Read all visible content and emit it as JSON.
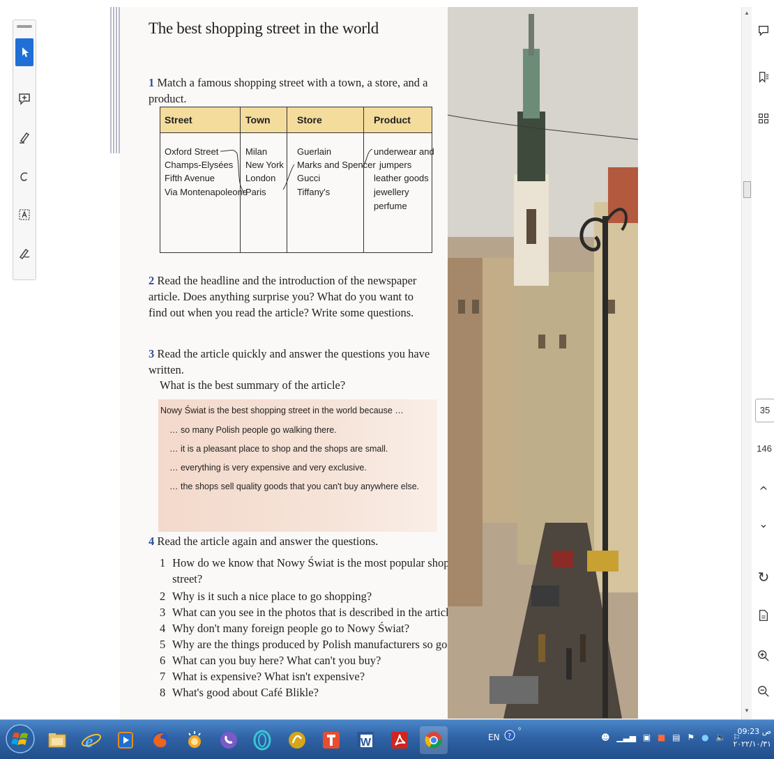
{
  "document": {
    "title": "The best shopping street in the world",
    "q1": {
      "num": "1",
      "text": "Match a famous shopping street with a town, a store, and a product."
    },
    "table": {
      "headers": [
        "Street",
        "Town",
        "Store",
        "Product"
      ],
      "street": [
        "Oxford Street",
        "Champs-Elysées",
        "Fifth Avenue",
        "Via Montenapoleone"
      ],
      "town": [
        "Milan",
        "New York",
        "London",
        "Paris"
      ],
      "store": [
        "Guerlain",
        "Marks and Spencer",
        "Gucci",
        "Tiffany's"
      ],
      "product": [
        "underwear and",
        "jumpers",
        "leather goods",
        "jewellery",
        "perfume"
      ]
    },
    "q2": {
      "num": "2",
      "text": "Read the headline and the introduction of the newspaper article. Does anything surprise you? What do you want to find out when you read the article? Write some questions."
    },
    "q3": {
      "num": "3",
      "text": "Read the article quickly and answer the questions you have written."
    },
    "summary_question": "What is the best summary of the article?",
    "summary": {
      "lead": "Nowy Świat is the best shopping street in the world because …",
      "options": [
        "… so many Polish people go walking there.",
        "… it is a pleasant place to shop and the shops are small.",
        "… everything is very expensive and very exclusive.",
        "… the shops sell quality goods that you can't buy anywhere else."
      ]
    },
    "q4": {
      "num": "4",
      "text": "Read the article again and answer the questions."
    },
    "q4_items": [
      {
        "n": "1",
        "t": "How do we know that Nowy Świat is the most popular shopping"
      },
      {
        "n": "",
        "t": "street?"
      },
      {
        "n": "2",
        "t": "Why is it such a nice place to go shopping?"
      },
      {
        "n": "3",
        "t": "What can you see in the photos that is described in the article?"
      },
      {
        "n": "4",
        "t": "Why don't many foreign people go to Nowy Świat?"
      },
      {
        "n": "5",
        "t": "Why are the things produced by Polish manufacturers so good?"
      },
      {
        "n": "6",
        "t": "What can you buy here? What can't you buy?"
      },
      {
        "n": "7",
        "t": "What is expensive? What isn't expensive?"
      },
      {
        "n": "8",
        "t": "What's good about Café Blikle?"
      }
    ]
  },
  "viewer": {
    "current_page": "35",
    "total_pages": "146"
  },
  "tools_left": [
    "select-tool",
    "add-comment-tool",
    "highlight-tool",
    "draw-tool",
    "text-tool",
    "sign-tool"
  ],
  "tools_right": [
    "comment-icon",
    "bookmark-list-icon",
    "grid-view-icon",
    "refresh-icon",
    "fit-page-icon",
    "zoom-in-icon",
    "zoom-out-icon"
  ],
  "taskbar": {
    "lang": "EN",
    "time": "09:23 ص",
    "date": "۲۰۲۲/۱۰/۳۱"
  }
}
